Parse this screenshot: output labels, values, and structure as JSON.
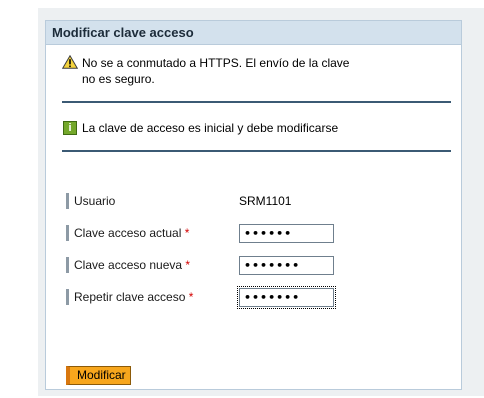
{
  "dialog": {
    "title": "Modificar clave acceso"
  },
  "messages": {
    "warning_line1": "No se a conmutado a HTTPS. El envío de la clave",
    "warning_line2": "no es seguro.",
    "info": "La clave de acceso es inicial y debe modificarse"
  },
  "form": {
    "user_label": "Usuario",
    "user_value": "SRM1101",
    "current_label": "Clave acceso actual",
    "current_value": "••••••",
    "new_label": "Clave acceso nueva",
    "new_value": "•••••••",
    "repeat_label": "Repetir clave acceso",
    "repeat_value": "•••••••",
    "required_mark": "*"
  },
  "actions": {
    "submit_label": "Modificar"
  },
  "colors": {
    "header_bg": "#d3e1ed",
    "button_bg": "#f7a61d",
    "required": "#d40000"
  },
  "icons": {
    "warning": "warning-icon",
    "info": "info-icon"
  }
}
